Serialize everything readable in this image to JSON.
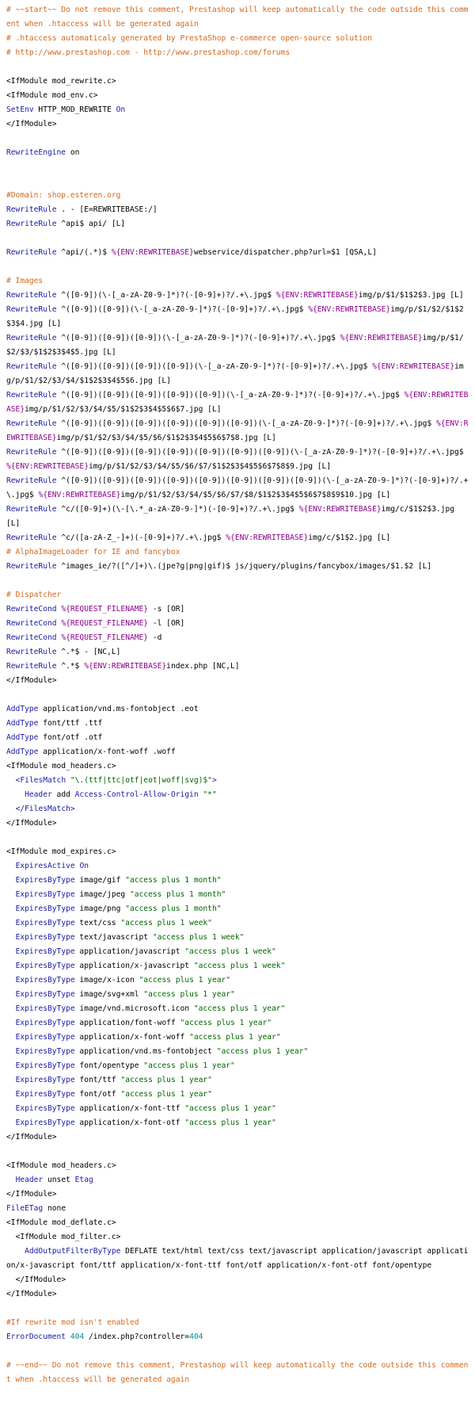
{
  "document": {
    "kind": "htaccess code listing",
    "token_colors": {
      "comment": "#d2691e",
      "directive": "#1a1aa6",
      "string": "#006600",
      "number": "#008b8b",
      "variable": "#8b008b",
      "text": "#000000"
    },
    "lines": [
      [
        [
          "cm",
          "# ~~start~~ Do not remove this comment, Prestashop will keep automatically the code outside this comment when .htaccess will be generated again"
        ]
      ],
      [
        [
          "cm",
          "# .htaccess automaticaly generated by PrestaShop e-commerce open-source solution"
        ]
      ],
      [
        [
          "cm",
          "# http://www.prestashop.com - http://www.prestashop.com/forums"
        ]
      ],
      [],
      [
        [
          "plain",
          "<IfModule mod_rewrite.c>"
        ]
      ],
      [
        [
          "plain",
          "<IfModule mod_env.c>"
        ]
      ],
      [
        [
          "dir",
          "SetEnv"
        ],
        [
          "plain",
          " HTTP_MOD_REWRITE "
        ],
        [
          "dir",
          "On"
        ]
      ],
      [
        [
          "plain",
          "</IfModule>"
        ]
      ],
      [],
      [
        [
          "dir",
          "RewriteEngine"
        ],
        [
          "plain",
          " on"
        ]
      ],
      [],
      [],
      [
        [
          "cm",
          "#Domain: shop.esteren.org"
        ]
      ],
      [
        [
          "dir",
          "RewriteRule"
        ],
        [
          "plain",
          " . - [E=REWRITEBASE:/]"
        ]
      ],
      [
        [
          "dir",
          "RewriteRule"
        ],
        [
          "plain",
          " ^api$ api/ [L]"
        ]
      ],
      [],
      [
        [
          "dir",
          "RewriteRule"
        ],
        [
          "plain",
          " ^api/(.*)$ "
        ],
        [
          "var",
          "%{ENV:REWRITEBASE}"
        ],
        [
          "plain",
          "webservice/dispatcher.php?url=$1 [QSA,L]"
        ]
      ],
      [],
      [
        [
          "cm",
          "# Images"
        ]
      ],
      [
        [
          "dir",
          "RewriteRule"
        ],
        [
          "plain",
          " ^([0-9])(\\-[_a-zA-Z0-9-]*)?(-[0-9]+)?/.+\\.jpg$ "
        ],
        [
          "var",
          "%{ENV:REWRITEBASE}"
        ],
        [
          "plain",
          "img/p/$1/$1$2$3.jpg [L]"
        ]
      ],
      [
        [
          "dir",
          "RewriteRule"
        ],
        [
          "plain",
          " ^([0-9])([0-9])(\\-[_a-zA-Z0-9-]*)?(-[0-9]+)?/.+\\.jpg$ "
        ],
        [
          "var",
          "%{ENV:REWRITEBASE}"
        ],
        [
          "plain",
          "img/p/$1/$2/$1$2$3$4.jpg [L]"
        ]
      ],
      [
        [
          "dir",
          "RewriteRule"
        ],
        [
          "plain",
          " ^([0-9])([0-9])([0-9])(\\-[_a-zA-Z0-9-]*)?(-[0-9]+)?/.+\\.jpg$ "
        ],
        [
          "var",
          "%{ENV:REWRITEBASE}"
        ],
        [
          "plain",
          "img/p/$1/$2/$3/$1$2$3$4$5.jpg [L]"
        ]
      ],
      [
        [
          "dir",
          "RewriteRule"
        ],
        [
          "plain",
          " ^([0-9])([0-9])([0-9])([0-9])(\\-[_a-zA-Z0-9-]*)?(-[0-9]+)?/.+\\.jpg$ "
        ],
        [
          "var",
          "%{ENV:REWRITEBASE}"
        ],
        [
          "plain",
          "img/p/$1/$2/$3/$4/$1$2$3$4$5$6.jpg [L]"
        ]
      ],
      [
        [
          "dir",
          "RewriteRule"
        ],
        [
          "plain",
          " ^([0-9])([0-9])([0-9])([0-9])([0-9])(\\-[_a-zA-Z0-9-]*)?(-[0-9]+)?/.+\\.jpg$ "
        ],
        [
          "var",
          "%{ENV:REWRITEBASE}"
        ],
        [
          "plain",
          "img/p/$1/$2/$3/$4/$5/$1$2$3$4$5$6$7.jpg [L]"
        ]
      ],
      [
        [
          "dir",
          "RewriteRule"
        ],
        [
          "plain",
          " ^([0-9])([0-9])([0-9])([0-9])([0-9])([0-9])(\\-[_a-zA-Z0-9-]*)?(-[0-9]+)?/.+\\.jpg$ "
        ],
        [
          "var",
          "%{ENV:REWRITEBASE}"
        ],
        [
          "plain",
          "img/p/$1/$2/$3/$4/$5/$6/$1$2$3$4$5$6$7$8.jpg [L]"
        ]
      ],
      [
        [
          "dir",
          "RewriteRule"
        ],
        [
          "plain",
          " ^([0-9])([0-9])([0-9])([0-9])([0-9])([0-9])([0-9])(\\-[_a-zA-Z0-9-]*)?(-[0-9]+)?/.+\\.jpg$ "
        ],
        [
          "var",
          "%{ENV:REWRITEBASE}"
        ],
        [
          "plain",
          "img/p/$1/$2/$3/$4/$5/$6/$7/$1$2$3$4$5$6$7$8$9.jpg [L]"
        ]
      ],
      [
        [
          "dir",
          "RewriteRule"
        ],
        [
          "plain",
          " ^([0-9])([0-9])([0-9])([0-9])([0-9])([0-9])([0-9])([0-9])(\\-[_a-zA-Z0-9-]*)?(-[0-9]+)?/.+\\.jpg$ "
        ],
        [
          "var",
          "%{ENV:REWRITEBASE}"
        ],
        [
          "plain",
          "img/p/$1/$2/$3/$4/$5/$6/$7/$8/$1$2$3$4$5$6$7$8$9$10.jpg [L]"
        ]
      ],
      [
        [
          "dir",
          "RewriteRule"
        ],
        [
          "plain",
          " ^c/([0-9]+)(\\-[\\.*_a-zA-Z0-9-]*)(-[0-9]+)?/.+\\.jpg$ "
        ],
        [
          "var",
          "%{ENV:REWRITEBASE}"
        ],
        [
          "plain",
          "img/c/$1$2$3.jpg [L]"
        ]
      ],
      [
        [
          "dir",
          "RewriteRule"
        ],
        [
          "plain",
          " ^c/([a-zA-Z_-]+)(-[0-9]+)?/.+\\.jpg$ "
        ],
        [
          "var",
          "%{ENV:REWRITEBASE}"
        ],
        [
          "plain",
          "img/c/$1$2.jpg [L]"
        ]
      ],
      [
        [
          "cm",
          "# AlphaImageLoader for IE and fancybox"
        ]
      ],
      [
        [
          "dir",
          "RewriteRule"
        ],
        [
          "plain",
          " ^images_ie/?([^/]+)\\.(jpe?g|png|gif)$ js/jquery/plugins/fancybox/images/$1.$2 [L]"
        ]
      ],
      [],
      [
        [
          "cm",
          "# Dispatcher"
        ]
      ],
      [
        [
          "dir",
          "RewriteCond"
        ],
        [
          "plain",
          " "
        ],
        [
          "var",
          "%{REQUEST_FILENAME}"
        ],
        [
          "plain",
          " -s [OR]"
        ]
      ],
      [
        [
          "dir",
          "RewriteCond"
        ],
        [
          "plain",
          " "
        ],
        [
          "var",
          "%{REQUEST_FILENAME}"
        ],
        [
          "plain",
          " -l [OR]"
        ]
      ],
      [
        [
          "dir",
          "RewriteCond"
        ],
        [
          "plain",
          " "
        ],
        [
          "var",
          "%{REQUEST_FILENAME}"
        ],
        [
          "plain",
          " -d"
        ]
      ],
      [
        [
          "dir",
          "RewriteRule"
        ],
        [
          "plain",
          " ^.*$ - [NC,L]"
        ]
      ],
      [
        [
          "dir",
          "RewriteRule"
        ],
        [
          "plain",
          " ^.*$ "
        ],
        [
          "var",
          "%{ENV:REWRITEBASE}"
        ],
        [
          "plain",
          "index.php [NC,L]"
        ]
      ],
      [
        [
          "plain",
          "</IfModule>"
        ]
      ],
      [],
      [
        [
          "dir",
          "AddType"
        ],
        [
          "plain",
          " application/vnd.ms-fontobject .eot"
        ]
      ],
      [
        [
          "dir",
          "AddType"
        ],
        [
          "plain",
          " font/ttf .ttf"
        ]
      ],
      [
        [
          "dir",
          "AddType"
        ],
        [
          "plain",
          " font/otf .otf"
        ]
      ],
      [
        [
          "dir",
          "AddType"
        ],
        [
          "plain",
          " application/x-font-woff .woff"
        ]
      ],
      [
        [
          "plain",
          "<IfModule mod_headers.c>"
        ]
      ],
      [
        [
          "plain",
          "  "
        ],
        [
          "dir",
          "<FilesMatch"
        ],
        [
          "plain",
          " "
        ],
        [
          "str",
          "\"\\.(ttf|ttc|otf|eot|woff|svg)$\""
        ],
        [
          "dir",
          ">"
        ]
      ],
      [
        [
          "plain",
          "    "
        ],
        [
          "dir",
          "Header"
        ],
        [
          "plain",
          " add "
        ],
        [
          "dir",
          "Access-Control-Allow-Origin"
        ],
        [
          "plain",
          " "
        ],
        [
          "str",
          "\"*\""
        ]
      ],
      [
        [
          "plain",
          "  "
        ],
        [
          "dir",
          "</FilesMatch>"
        ]
      ],
      [
        [
          "plain",
          "</IfModule>"
        ]
      ],
      [],
      [
        [
          "plain",
          "<IfModule mod_expires.c>"
        ]
      ],
      [
        [
          "plain",
          "  "
        ],
        [
          "dir",
          "ExpiresActive"
        ],
        [
          "plain",
          " "
        ],
        [
          "dir",
          "On"
        ]
      ],
      [
        [
          "plain",
          "  "
        ],
        [
          "dir",
          "ExpiresByType"
        ],
        [
          "plain",
          " image/gif "
        ],
        [
          "str",
          "\"access plus 1 month\""
        ]
      ],
      [
        [
          "plain",
          "  "
        ],
        [
          "dir",
          "ExpiresByType"
        ],
        [
          "plain",
          " image/jpeg "
        ],
        [
          "str",
          "\"access plus 1 month\""
        ]
      ],
      [
        [
          "plain",
          "  "
        ],
        [
          "dir",
          "ExpiresByType"
        ],
        [
          "plain",
          " image/png "
        ],
        [
          "str",
          "\"access plus 1 month\""
        ]
      ],
      [
        [
          "plain",
          "  "
        ],
        [
          "dir",
          "ExpiresByType"
        ],
        [
          "plain",
          " text/css "
        ],
        [
          "str",
          "\"access plus 1 week\""
        ]
      ],
      [
        [
          "plain",
          "  "
        ],
        [
          "dir",
          "ExpiresByType"
        ],
        [
          "plain",
          " text/javascript "
        ],
        [
          "str",
          "\"access plus 1 week\""
        ]
      ],
      [
        [
          "plain",
          "  "
        ],
        [
          "dir",
          "ExpiresByType"
        ],
        [
          "plain",
          " application/javascript "
        ],
        [
          "str",
          "\"access plus 1 week\""
        ]
      ],
      [
        [
          "plain",
          "  "
        ],
        [
          "dir",
          "ExpiresByType"
        ],
        [
          "plain",
          " application/x-javascript "
        ],
        [
          "str",
          "\"access plus 1 week\""
        ]
      ],
      [
        [
          "plain",
          "  "
        ],
        [
          "dir",
          "ExpiresByType"
        ],
        [
          "plain",
          " image/x-icon "
        ],
        [
          "str",
          "\"access plus 1 year\""
        ]
      ],
      [
        [
          "plain",
          "  "
        ],
        [
          "dir",
          "ExpiresByType"
        ],
        [
          "plain",
          " image/svg+xml "
        ],
        [
          "str",
          "\"access plus 1 year\""
        ]
      ],
      [
        [
          "plain",
          "  "
        ],
        [
          "dir",
          "ExpiresByType"
        ],
        [
          "plain",
          " image/vnd.microsoft.icon "
        ],
        [
          "str",
          "\"access plus 1 year\""
        ]
      ],
      [
        [
          "plain",
          "  "
        ],
        [
          "dir",
          "ExpiresByType"
        ],
        [
          "plain",
          " application/font-woff "
        ],
        [
          "str",
          "\"access plus 1 year\""
        ]
      ],
      [
        [
          "plain",
          "  "
        ],
        [
          "dir",
          "ExpiresByType"
        ],
        [
          "plain",
          " application/x-font-woff "
        ],
        [
          "str",
          "\"access plus 1 year\""
        ]
      ],
      [
        [
          "plain",
          "  "
        ],
        [
          "dir",
          "ExpiresByType"
        ],
        [
          "plain",
          " application/vnd.ms-fontobject "
        ],
        [
          "str",
          "\"access plus 1 year\""
        ]
      ],
      [
        [
          "plain",
          "  "
        ],
        [
          "dir",
          "ExpiresByType"
        ],
        [
          "plain",
          " font/opentype "
        ],
        [
          "str",
          "\"access plus 1 year\""
        ]
      ],
      [
        [
          "plain",
          "  "
        ],
        [
          "dir",
          "ExpiresByType"
        ],
        [
          "plain",
          " font/ttf "
        ],
        [
          "str",
          "\"access plus 1 year\""
        ]
      ],
      [
        [
          "plain",
          "  "
        ],
        [
          "dir",
          "ExpiresByType"
        ],
        [
          "plain",
          " font/otf "
        ],
        [
          "str",
          "\"access plus 1 year\""
        ]
      ],
      [
        [
          "plain",
          "  "
        ],
        [
          "dir",
          "ExpiresByType"
        ],
        [
          "plain",
          " application/x-font-ttf "
        ],
        [
          "str",
          "\"access plus 1 year\""
        ]
      ],
      [
        [
          "plain",
          "  "
        ],
        [
          "dir",
          "ExpiresByType"
        ],
        [
          "plain",
          " application/x-font-otf "
        ],
        [
          "str",
          "\"access plus 1 year\""
        ]
      ],
      [
        [
          "plain",
          "</IfModule>"
        ]
      ],
      [],
      [
        [
          "plain",
          "<IfModule mod_headers.c>"
        ]
      ],
      [
        [
          "plain",
          "  "
        ],
        [
          "dir",
          "Header"
        ],
        [
          "plain",
          " unset "
        ],
        [
          "dir",
          "Etag"
        ]
      ],
      [
        [
          "plain",
          "</IfModule>"
        ]
      ],
      [
        [
          "dir",
          "FileETag"
        ],
        [
          "plain",
          " none"
        ]
      ],
      [
        [
          "plain",
          "<IfModule mod_deflate.c>"
        ]
      ],
      [
        [
          "plain",
          "  <IfModule mod_filter.c>"
        ]
      ],
      [
        [
          "plain",
          "    "
        ],
        [
          "dir",
          "AddOutputFilterByType"
        ],
        [
          "plain",
          " DEFLATE text/html text/css text/javascript application/javascript application/x-javascript font/ttf application/x-font-ttf font/otf application/x-font-otf font/opentype"
        ]
      ],
      [
        [
          "plain",
          "  </IfModule>"
        ]
      ],
      [
        [
          "plain",
          "</IfModule>"
        ]
      ],
      [],
      [
        [
          "cm",
          "#If rewrite mod isn't enabled"
        ]
      ],
      [
        [
          "dir",
          "ErrorDocument"
        ],
        [
          "plain",
          " "
        ],
        [
          "num",
          "404"
        ],
        [
          "plain",
          " /index.php?controller="
        ],
        [
          "num",
          "404"
        ]
      ],
      [],
      [
        [
          "cm",
          "# ~~end~~ Do not remove this comment, Prestashop will keep automatically the code outside this comment when .htaccess will be generated again"
        ]
      ]
    ]
  }
}
